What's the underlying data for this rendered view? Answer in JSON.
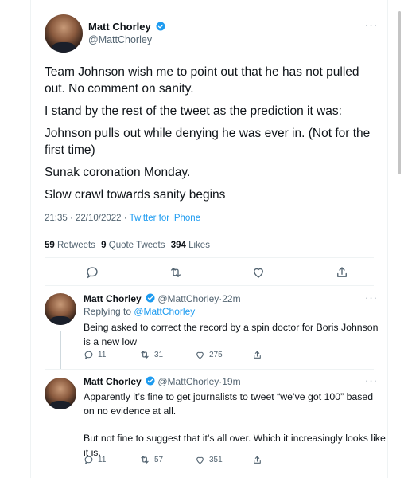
{
  "main": {
    "author_name": "Matt Chorley",
    "author_handle": "@MattChorley",
    "paragraphs": [
      "Team Johnson wish me to point out that he has not pulled out. No comment on sanity.",
      "I stand by the rest of the tweet as the prediction it was:",
      "Johnson pulls out while denying he was ever in. (Not for the first time)",
      "Sunak coronation Monday.",
      "Slow crawl towards sanity begins"
    ],
    "time": "21:35",
    "date": "22/10/2022",
    "source": "Twitter for iPhone",
    "retweets_count": "59",
    "retweets_label": "Retweets",
    "quotes_count": "9",
    "quotes_label": "Quote Tweets",
    "likes_count": "394",
    "likes_label": "Likes",
    "more_label": "···"
  },
  "replies": [
    {
      "author_name": "Matt Chorley",
      "author_handle": "@MattChorley",
      "age": "22m",
      "replying_prefix": "Replying to ",
      "replying_to": "@MattChorley",
      "paragraphs": [
        "Being asked to correct the record by a spin doctor for Boris Johnson is a new low"
      ],
      "replies_count": "11",
      "retweets_count": "31",
      "likes_count": "275"
    },
    {
      "author_name": "Matt Chorley",
      "author_handle": "@MattChorley",
      "age": "19m",
      "paragraphs": [
        "Apparently it’s fine to get journalists to tweet “we’ve got 100” based on no evidence at all.",
        "But not fine to suggest that it’s all over. Which it increasingly looks like it is."
      ],
      "replies_count": "11",
      "retweets_count": "57",
      "likes_count": "351"
    }
  ],
  "colors": {
    "accent": "#1d9bf0",
    "text": "#0f1419",
    "muted": "#536471",
    "border": "#eff3f4"
  },
  "icons": [
    "verified-badge-icon",
    "reply-icon",
    "retweet-icon",
    "like-icon",
    "share-icon",
    "more-icon"
  ]
}
